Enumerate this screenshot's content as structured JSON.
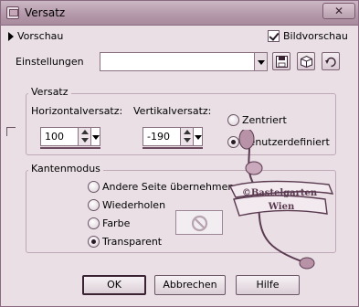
{
  "window": {
    "title": "Versatz",
    "close_label": "✕"
  },
  "preview": {
    "toggle_label": "Vorschau",
    "image_preview_label": "Bildvorschau",
    "image_preview_checked": true
  },
  "settings": {
    "label": "Einstellungen",
    "value": ""
  },
  "offset": {
    "group_title": "Versatz",
    "horizontal_label": "Horizontalversatz:",
    "horizontal_value": "100",
    "vertical_label": "Vertikalversatz:",
    "vertical_value": "-190",
    "options": [
      {
        "label": "Zentriert",
        "selected": false
      },
      {
        "label": "Benutzerdefiniert",
        "selected": true
      }
    ]
  },
  "edge_mode": {
    "group_title": "Kantenmodus",
    "options": [
      {
        "label": "Andere Seite übernehmen",
        "selected": false
      },
      {
        "label": "Wiederholen",
        "selected": false
      },
      {
        "label": "Farbe",
        "selected": false
      },
      {
        "label": "Transparent",
        "selected": true
      }
    ]
  },
  "watermark": {
    "line1": "©Bastelgarten",
    "line2": "Wien"
  },
  "buttons": {
    "ok": "OK",
    "cancel": "Abbrechen",
    "help": "Hilfe"
  },
  "colors": {
    "accent": "#a88b9c",
    "dialog_bg": "#e9dfe5",
    "border": "#8a6a80"
  },
  "icons": {
    "save": "save-icon",
    "load": "load-icon",
    "reset": "reset-icon",
    "no_color": "no-color-icon"
  }
}
